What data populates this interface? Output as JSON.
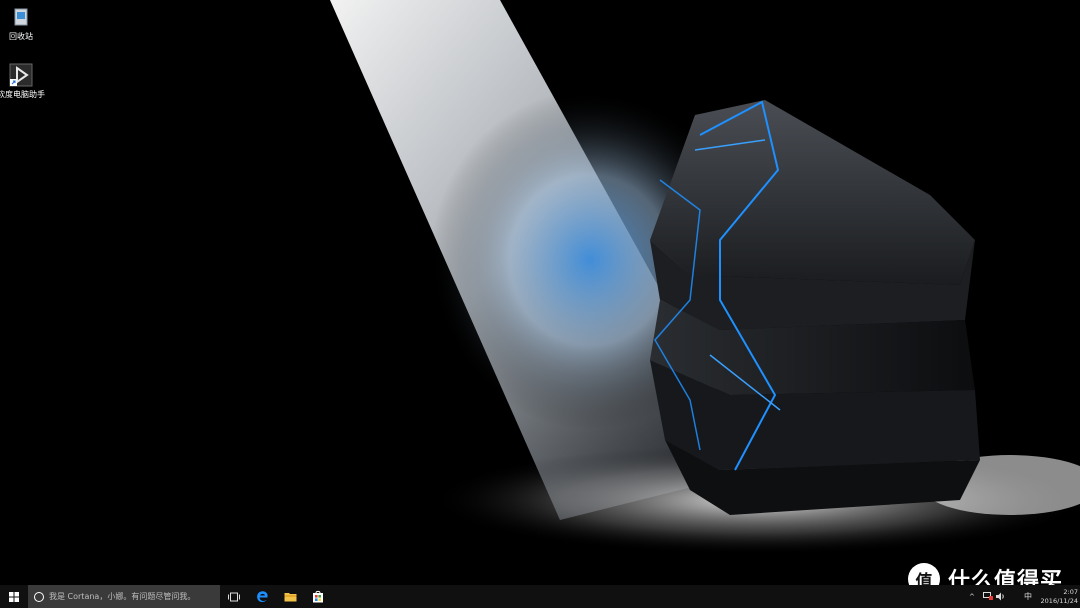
{
  "desktop": {
    "icons": [
      {
        "label": "回收站",
        "icon": "recycle-bin-icon"
      },
      {
        "label": "软度电脑助手",
        "icon": "pc-assistant-shortcut-icon"
      }
    ]
  },
  "taskbar": {
    "start_icon": "windows-logo-icon",
    "search": {
      "placeholder": "我是 Cortana，小娜。有问题尽管问我。",
      "icon": "cortana-ring-icon"
    },
    "pinned": [
      {
        "name": "task-view",
        "icon": "task-view-icon"
      },
      {
        "name": "edge",
        "icon": "edge-browser-icon"
      },
      {
        "name": "file-explorer",
        "icon": "folder-icon"
      },
      {
        "name": "store",
        "icon": "store-bag-icon"
      }
    ],
    "tray": {
      "chevron": "^",
      "ime": "中",
      "time": "2:07",
      "date": "2016/11/24"
    }
  },
  "watermark": {
    "badge": "值",
    "text": "什么值得买"
  },
  "colors": {
    "taskbar_bg": "#101010",
    "search_bg": "#3a3a3a",
    "accent_blue": "#1e90ff",
    "wallpaper_bg": "#000000"
  }
}
